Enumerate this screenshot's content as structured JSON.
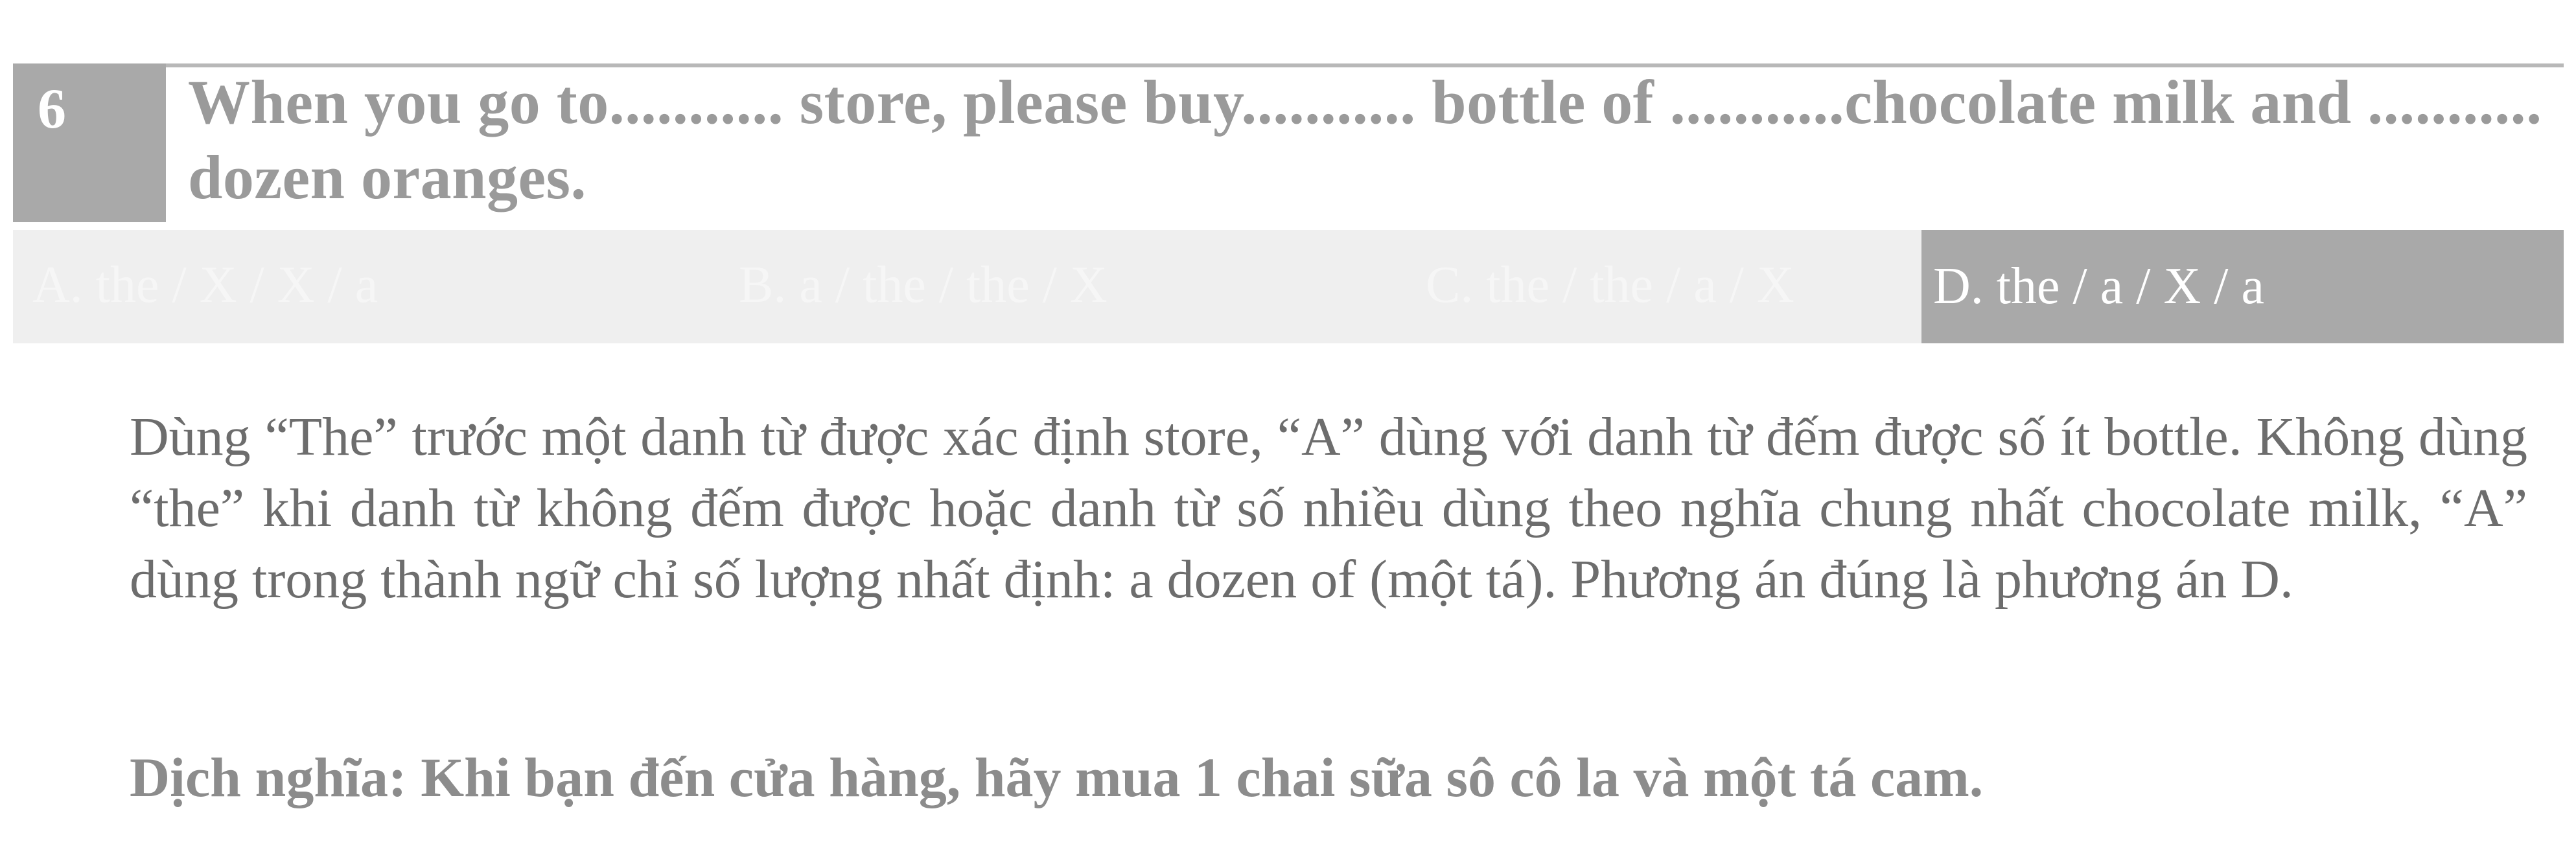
{
  "question": {
    "number": "6",
    "text": "When you go to........... store, please buy........... bottle of ...........chocolate milk and ........... dozen oranges."
  },
  "options": {
    "a": "A. the / X / X / a",
    "b": "B. a / the / the / X",
    "c": "C. the / the / a / X",
    "d": "D. the / a / X / a"
  },
  "explanation": "Dùng “The” trước một danh từ được xác định store, “A” dùng với danh từ đếm được số ít bottle. Không dùng “the” khi danh từ không đếm được hoặc danh từ số nhiều dùng theo nghĩa chung nhất chocolate milk, “A” dùng trong thành ngữ chỉ số lượng nhất định: a dozen of (một tá). Phương án đúng là phương án D.",
  "translation": "Dịch nghĩa: Khi bạn đến cửa hàng, hãy mua 1 chai sữa sô cô la và một tá cam.",
  "colors": {
    "number_bg": "#a9a9a9",
    "question_text": "#9a9a9a",
    "answer_bg": "#a9a9a9",
    "body_text": "#6d6d6d"
  }
}
